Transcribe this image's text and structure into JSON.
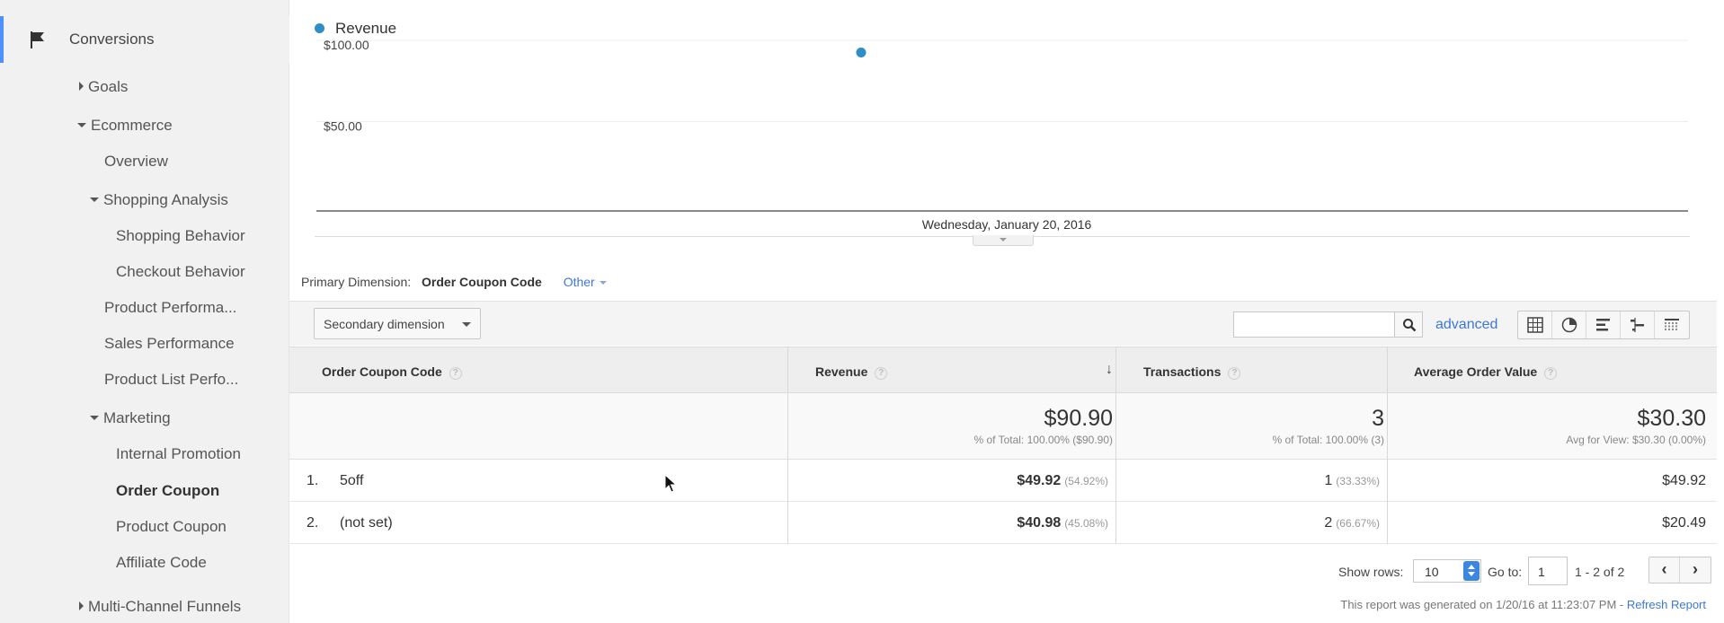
{
  "sidebar": {
    "section": {
      "label": "Conversions",
      "icon": "flag-icon"
    },
    "items": [
      {
        "label": "Goals",
        "expander": "collapsed"
      },
      {
        "label": "Ecommerce",
        "expander": "expanded"
      },
      {
        "label": "Overview"
      },
      {
        "label": "Shopping Analysis",
        "expander": "expanded"
      },
      {
        "label": "Shopping Behavior"
      },
      {
        "label": "Checkout Behavior"
      },
      {
        "label": "Product Performa..."
      },
      {
        "label": "Sales Performance"
      },
      {
        "label": "Product List Perfo..."
      },
      {
        "label": "Marketing",
        "expander": "expanded"
      },
      {
        "label": "Internal Promotion"
      },
      {
        "label": "Order Coupon",
        "active": true
      },
      {
        "label": "Product Coupon"
      },
      {
        "label": "Affiliate Code"
      },
      {
        "label": "Multi-Channel Funnels",
        "expander": "collapsed"
      }
    ]
  },
  "chart": {
    "legend": "Revenue",
    "color": "#2e8ec6",
    "date_label": "Wednesday, January 20, 2016"
  },
  "chart_data": {
    "type": "scatter",
    "series": [
      {
        "name": "Revenue",
        "values": [
          90.9
        ]
      }
    ],
    "x": [
      "Wednesday, January 20, 2016"
    ],
    "yticks": [
      "$100.00",
      "$50.00"
    ],
    "ylim": [
      0,
      100
    ]
  },
  "primary_dimension": {
    "label": "Primary Dimension:",
    "value": "Order Coupon Code",
    "other": "Other"
  },
  "toolbar": {
    "secondary_dimension": "Secondary dimension",
    "search_value": "",
    "advanced": "advanced",
    "views": [
      "table-view-icon",
      "pie-view-icon",
      "performance-view-icon",
      "comparison-view-icon",
      "pivot-view-icon"
    ]
  },
  "table": {
    "columns": {
      "code": "Order Coupon Code",
      "revenue": "Revenue",
      "transactions": "Transactions",
      "aov": "Average Order Value"
    },
    "help_glyph": "?",
    "sort_glyph": "↓",
    "totals": {
      "revenue": "$90.90",
      "revenue_sub": "% of Total: 100.00% ($90.90)",
      "transactions": "3",
      "transactions_sub": "% of Total: 100.00% (3)",
      "aov": "$30.30",
      "aov_sub": "Avg for View: $30.30 (0.00%)"
    },
    "rows": [
      {
        "num": "1.",
        "code": "5off",
        "revenue": "$49.92",
        "revenue_pct": "(54.92%)",
        "transactions": "1",
        "transactions_pct": "(33.33%)",
        "aov": "$49.92"
      },
      {
        "num": "2.",
        "code": "(not set)",
        "revenue": "$40.98",
        "revenue_pct": "(45.08%)",
        "transactions": "2",
        "transactions_pct": "(66.67%)",
        "aov": "$20.49"
      }
    ]
  },
  "footer": {
    "show_rows_label": "Show rows:",
    "show_rows_value": "10",
    "goto_label": "Go to:",
    "goto_value": "1",
    "range": "1 - 2 of 2",
    "prev": "‹",
    "next": "›",
    "generated": "This report was generated on 1/20/16 at 11:23:07 PM - ",
    "refresh": "Refresh Report"
  }
}
